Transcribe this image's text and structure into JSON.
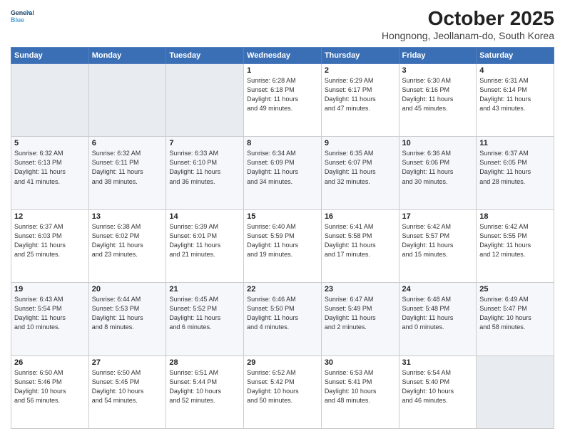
{
  "logo": {
    "line1": "General",
    "line2": "Blue"
  },
  "title": "October 2025",
  "subtitle": "Hongnong, Jeollanam-do, South Korea",
  "headers": [
    "Sunday",
    "Monday",
    "Tuesday",
    "Wednesday",
    "Thursday",
    "Friday",
    "Saturday"
  ],
  "weeks": [
    [
      {
        "day": "",
        "info": ""
      },
      {
        "day": "",
        "info": ""
      },
      {
        "day": "",
        "info": ""
      },
      {
        "day": "1",
        "info": "Sunrise: 6:28 AM\nSunset: 6:18 PM\nDaylight: 11 hours\nand 49 minutes."
      },
      {
        "day": "2",
        "info": "Sunrise: 6:29 AM\nSunset: 6:17 PM\nDaylight: 11 hours\nand 47 minutes."
      },
      {
        "day": "3",
        "info": "Sunrise: 6:30 AM\nSunset: 6:16 PM\nDaylight: 11 hours\nand 45 minutes."
      },
      {
        "day": "4",
        "info": "Sunrise: 6:31 AM\nSunset: 6:14 PM\nDaylight: 11 hours\nand 43 minutes."
      }
    ],
    [
      {
        "day": "5",
        "info": "Sunrise: 6:32 AM\nSunset: 6:13 PM\nDaylight: 11 hours\nand 41 minutes."
      },
      {
        "day": "6",
        "info": "Sunrise: 6:32 AM\nSunset: 6:11 PM\nDaylight: 11 hours\nand 38 minutes."
      },
      {
        "day": "7",
        "info": "Sunrise: 6:33 AM\nSunset: 6:10 PM\nDaylight: 11 hours\nand 36 minutes."
      },
      {
        "day": "8",
        "info": "Sunrise: 6:34 AM\nSunset: 6:09 PM\nDaylight: 11 hours\nand 34 minutes."
      },
      {
        "day": "9",
        "info": "Sunrise: 6:35 AM\nSunset: 6:07 PM\nDaylight: 11 hours\nand 32 minutes."
      },
      {
        "day": "10",
        "info": "Sunrise: 6:36 AM\nSunset: 6:06 PM\nDaylight: 11 hours\nand 30 minutes."
      },
      {
        "day": "11",
        "info": "Sunrise: 6:37 AM\nSunset: 6:05 PM\nDaylight: 11 hours\nand 28 minutes."
      }
    ],
    [
      {
        "day": "12",
        "info": "Sunrise: 6:37 AM\nSunset: 6:03 PM\nDaylight: 11 hours\nand 25 minutes."
      },
      {
        "day": "13",
        "info": "Sunrise: 6:38 AM\nSunset: 6:02 PM\nDaylight: 11 hours\nand 23 minutes."
      },
      {
        "day": "14",
        "info": "Sunrise: 6:39 AM\nSunset: 6:01 PM\nDaylight: 11 hours\nand 21 minutes."
      },
      {
        "day": "15",
        "info": "Sunrise: 6:40 AM\nSunset: 5:59 PM\nDaylight: 11 hours\nand 19 minutes."
      },
      {
        "day": "16",
        "info": "Sunrise: 6:41 AM\nSunset: 5:58 PM\nDaylight: 11 hours\nand 17 minutes."
      },
      {
        "day": "17",
        "info": "Sunrise: 6:42 AM\nSunset: 5:57 PM\nDaylight: 11 hours\nand 15 minutes."
      },
      {
        "day": "18",
        "info": "Sunrise: 6:42 AM\nSunset: 5:55 PM\nDaylight: 11 hours\nand 12 minutes."
      }
    ],
    [
      {
        "day": "19",
        "info": "Sunrise: 6:43 AM\nSunset: 5:54 PM\nDaylight: 11 hours\nand 10 minutes."
      },
      {
        "day": "20",
        "info": "Sunrise: 6:44 AM\nSunset: 5:53 PM\nDaylight: 11 hours\nand 8 minutes."
      },
      {
        "day": "21",
        "info": "Sunrise: 6:45 AM\nSunset: 5:52 PM\nDaylight: 11 hours\nand 6 minutes."
      },
      {
        "day": "22",
        "info": "Sunrise: 6:46 AM\nSunset: 5:50 PM\nDaylight: 11 hours\nand 4 minutes."
      },
      {
        "day": "23",
        "info": "Sunrise: 6:47 AM\nSunset: 5:49 PM\nDaylight: 11 hours\nand 2 minutes."
      },
      {
        "day": "24",
        "info": "Sunrise: 6:48 AM\nSunset: 5:48 PM\nDaylight: 11 hours\nand 0 minutes."
      },
      {
        "day": "25",
        "info": "Sunrise: 6:49 AM\nSunset: 5:47 PM\nDaylight: 10 hours\nand 58 minutes."
      }
    ],
    [
      {
        "day": "26",
        "info": "Sunrise: 6:50 AM\nSunset: 5:46 PM\nDaylight: 10 hours\nand 56 minutes."
      },
      {
        "day": "27",
        "info": "Sunrise: 6:50 AM\nSunset: 5:45 PM\nDaylight: 10 hours\nand 54 minutes."
      },
      {
        "day": "28",
        "info": "Sunrise: 6:51 AM\nSunset: 5:44 PM\nDaylight: 10 hours\nand 52 minutes."
      },
      {
        "day": "29",
        "info": "Sunrise: 6:52 AM\nSunset: 5:42 PM\nDaylight: 10 hours\nand 50 minutes."
      },
      {
        "day": "30",
        "info": "Sunrise: 6:53 AM\nSunset: 5:41 PM\nDaylight: 10 hours\nand 48 minutes."
      },
      {
        "day": "31",
        "info": "Sunrise: 6:54 AM\nSunset: 5:40 PM\nDaylight: 10 hours\nand 46 minutes."
      },
      {
        "day": "",
        "info": ""
      }
    ]
  ]
}
